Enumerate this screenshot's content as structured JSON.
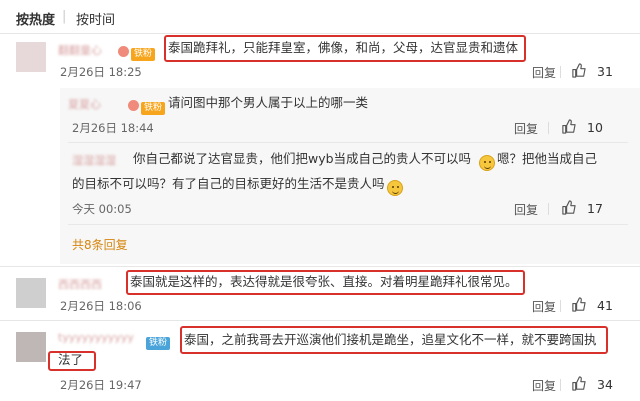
{
  "sort": {
    "hot": "按热度",
    "time": "按时间"
  },
  "comments": [
    {
      "name": "翻翻童心",
      "badge": "铁粉",
      "text": "泰国跪拜礼，只能拜皇室，佛像，和尚，父母，达官显贵和遗体",
      "time": "2月26日 18:25",
      "reply": "回复",
      "likes": "31"
    },
    {
      "name": "夏夏心",
      "badge": "铁粉",
      "text": "请问图中那个男人属于以上的哪一类",
      "time": "2月26日 18:44",
      "reply": "回复",
      "likes": "10"
    },
    {
      "name": "湿湿湿湿",
      "text1": "你自己都说了达官显贵，他们把wyb当成自己的贵人不可以吗",
      "text1b": "嗯？把他当成自己",
      "text2": "的目标不可以吗？有了自己的目标更好的生活不是贵人吗",
      "time": "今天 00:05",
      "reply": "回复",
      "likes": "17"
    },
    {
      "more": "共8条回复"
    },
    {
      "name": "西西西西",
      "text": "泰国就是这样的，表达得就是很夸张、直接。对着明星跪拜礼很常见。",
      "time": "2月26日 18:06",
      "reply": "回复",
      "likes": "41"
    },
    {
      "name": "tyyyyyyyyyyy",
      "badge": "铁粉",
      "text1": "泰国，之前我哥去开巡演他们接机是跪坐，追星文化不一样，就不要跨国执",
      "text2": "法了",
      "time": "2月26日 19:47",
      "reply": "回复",
      "likes": "34"
    }
  ],
  "colors": {
    "highlight": "#d8312b",
    "more_link": "#d6860e",
    "badge_fan": "#f7a51c"
  },
  "icons": {
    "like": "thumb-up-icon",
    "emoji": "smiley-emoji-icon"
  }
}
